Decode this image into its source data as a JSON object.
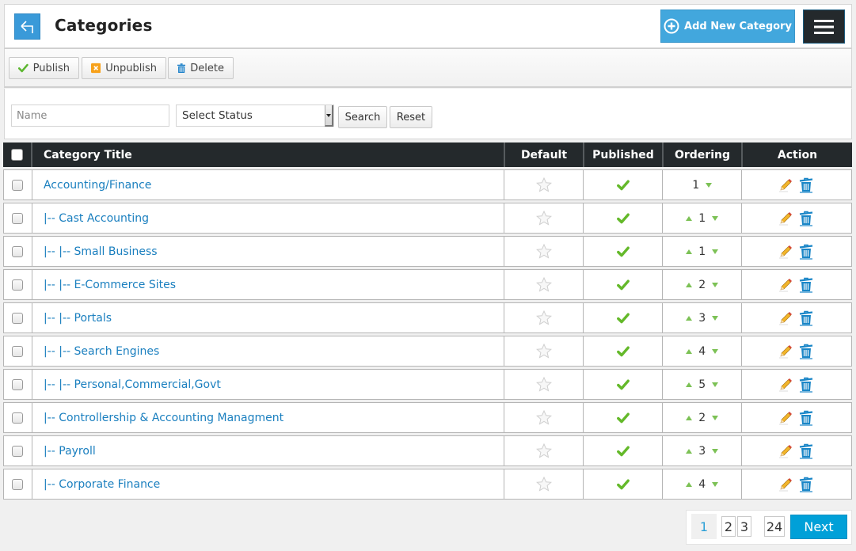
{
  "header": {
    "title": "Categories",
    "back_icon": "arrow-back-icon",
    "add_button_label": "Add New Category",
    "add_icon": "plus-circle-icon",
    "menu_icon": "hamburger-icon"
  },
  "toolbar": {
    "publish_label": "Publish",
    "unpublish_label": "Unpublish",
    "delete_label": "Delete"
  },
  "filter": {
    "name_placeholder": "Name",
    "name_value": "",
    "status_selected": "Select Status",
    "search_label": "Search",
    "reset_label": "Reset"
  },
  "table": {
    "columns": [
      "Category Title",
      "Default",
      "Published",
      "Ordering",
      "Action"
    ],
    "rows": [
      {
        "title": "Accounting/Finance",
        "prefix": "",
        "default": false,
        "published": true,
        "ordering": "1",
        "up": false,
        "down": true
      },
      {
        "title": "Cast Accounting",
        "prefix": "|-- ",
        "default": false,
        "published": true,
        "ordering": "1",
        "up": true,
        "down": true
      },
      {
        "title": "Small Business",
        "prefix": "|-- |-- ",
        "default": false,
        "published": true,
        "ordering": "1",
        "up": true,
        "down": true
      },
      {
        "title": "E-Commerce Sites",
        "prefix": "|-- |-- ",
        "default": false,
        "published": true,
        "ordering": "2",
        "up": true,
        "down": true
      },
      {
        "title": "Portals",
        "prefix": "|-- |-- ",
        "default": false,
        "published": true,
        "ordering": "3",
        "up": true,
        "down": true
      },
      {
        "title": "Search Engines",
        "prefix": "|-- |-- ",
        "default": false,
        "published": true,
        "ordering": "4",
        "up": true,
        "down": true
      },
      {
        "title": "Personal,Commercial,Govt",
        "prefix": "|-- |-- ",
        "default": false,
        "published": true,
        "ordering": "5",
        "up": true,
        "down": true
      },
      {
        "title": "Controllership & Accounting Managment",
        "prefix": "|-- ",
        "default": false,
        "published": true,
        "ordering": "2",
        "up": true,
        "down": true
      },
      {
        "title": "Payroll",
        "prefix": "|-- ",
        "default": false,
        "published": true,
        "ordering": "3",
        "up": true,
        "down": true
      },
      {
        "title": "Corporate Finance",
        "prefix": "|-- ",
        "default": false,
        "published": true,
        "ordering": "4",
        "up": true,
        "down": true
      }
    ]
  },
  "pagination": {
    "current": "1",
    "pages": [
      "2",
      "3"
    ],
    "ellipsis": "...",
    "last": "24",
    "next_label": "Next"
  },
  "colors": {
    "accent": "#42a7dd",
    "header_dark": "#24292c",
    "link": "#1a7fbf",
    "published_green": "#6cbf2a",
    "next_button": "#00a0d8"
  }
}
